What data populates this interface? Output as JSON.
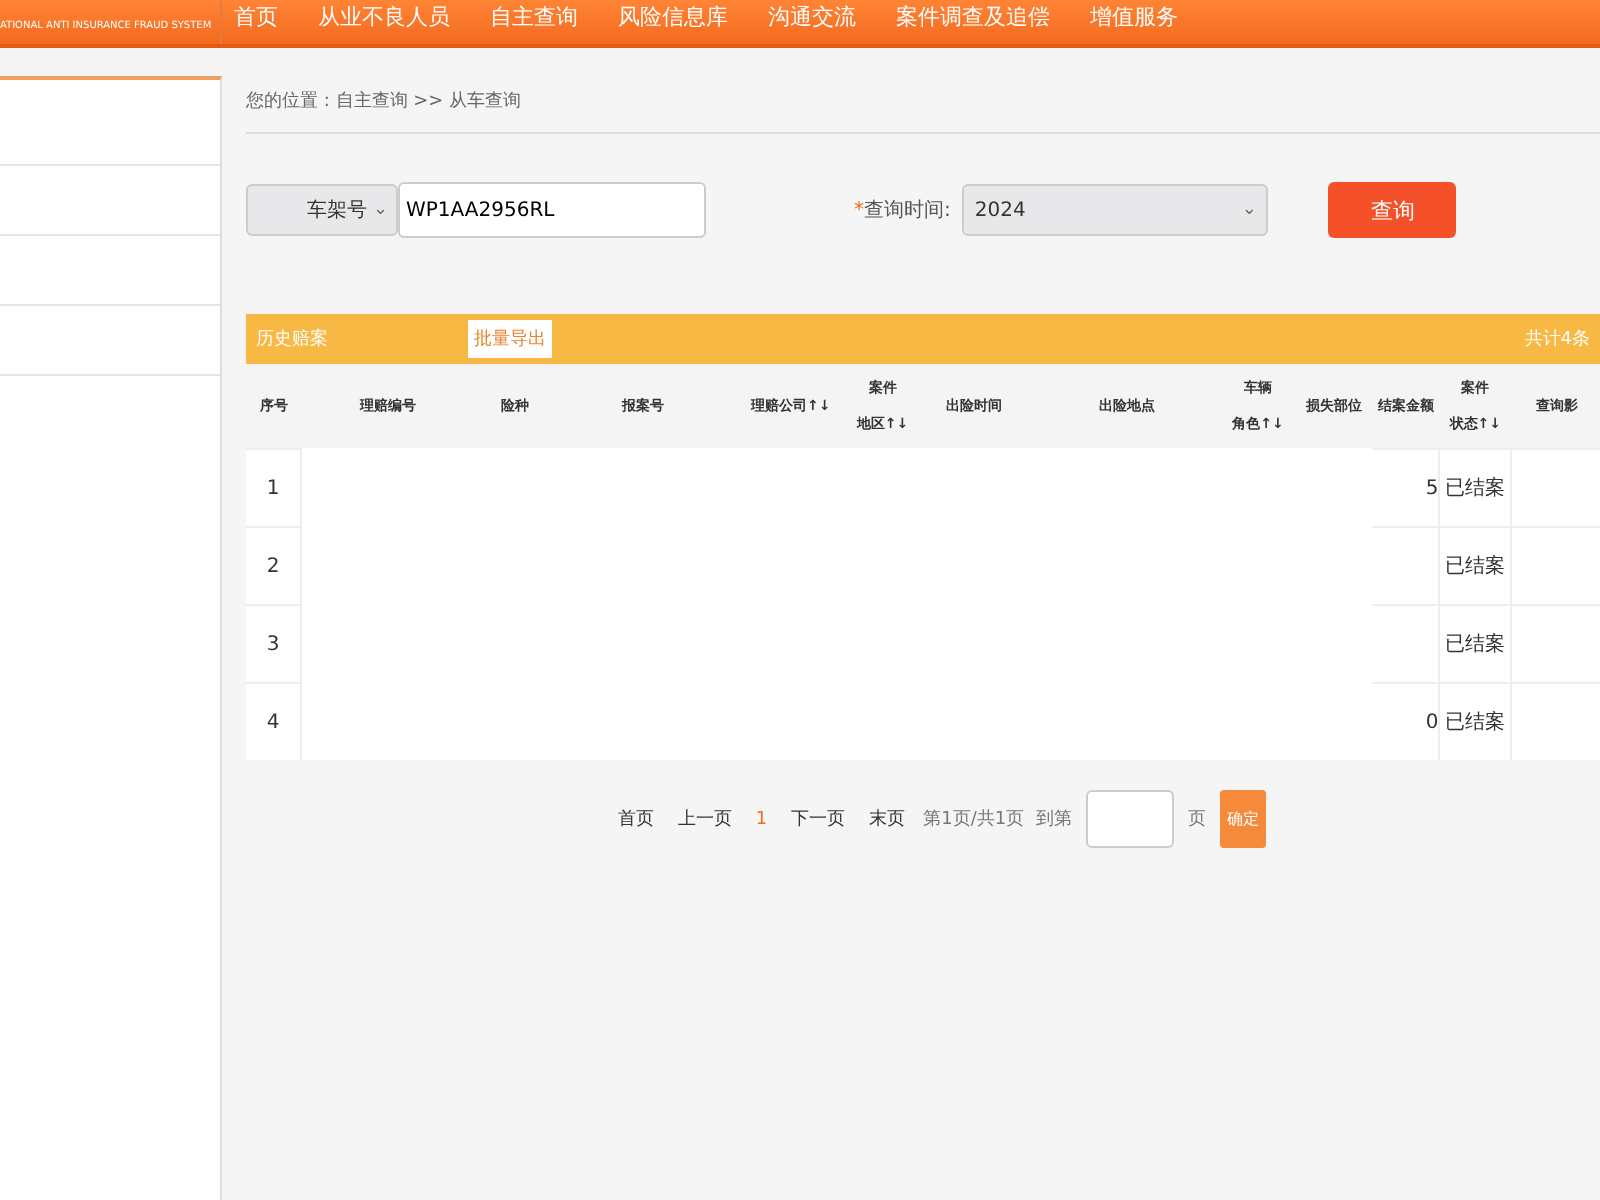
{
  "logo": {
    "subtitle": "ATIONAL ANTI INSURANCE FRAUD SYSTEM"
  },
  "nav": [
    {
      "label": "首页"
    },
    {
      "label": "从业不良人员"
    },
    {
      "label": "自主查询"
    },
    {
      "label": "风险信息库"
    },
    {
      "label": "沟通交流"
    },
    {
      "label": "案件调查及追偿"
    },
    {
      "label": "增值服务"
    }
  ],
  "breadcrumb": "您的位置 : 自主查询 >> 从车查询",
  "search": {
    "type_select": "车架号",
    "chevron": "⌄",
    "required_mark": "*",
    "value": "WP1AA2956RL",
    "time_label": "查询时间:",
    "time_value": "2024",
    "button": "查询"
  },
  "panel": {
    "title": "历史赔案",
    "export_button": "批量导出",
    "total": "共计4条"
  },
  "table": {
    "columns": [
      {
        "lines": [
          "序号"
        ]
      },
      {
        "lines": [
          "理赔编号"
        ]
      },
      {
        "lines": [
          "险种"
        ]
      },
      {
        "lines": [
          "报案号"
        ]
      },
      {
        "lines": [
          "理赔公司↑↓"
        ]
      },
      {
        "lines": [
          "案件",
          "地区↑↓"
        ]
      },
      {
        "lines": [
          "出险时间"
        ]
      },
      {
        "lines": [
          "出险地点"
        ]
      },
      {
        "lines": [
          "车辆",
          "角色↑↓"
        ]
      },
      {
        "lines": [
          "损失部位"
        ]
      },
      {
        "lines": [
          "结案金额"
        ]
      },
      {
        "lines": [
          "案件",
          "状态↑↓"
        ]
      },
      {
        "lines": [
          "查询影"
        ]
      }
    ],
    "rows": [
      {
        "index": "1",
        "amount": "5",
        "status": "已结案"
      },
      {
        "index": "2",
        "status": "已结案"
      },
      {
        "index": "3",
        "status": "已结案"
      },
      {
        "index": "4",
        "amount": "0",
        "status": "已结案"
      }
    ]
  },
  "pagination": {
    "first": "首页",
    "prev": "上一页",
    "current": "1",
    "next": "下一页",
    "last": "末页",
    "info": "第1页/共1页",
    "goto": "到第",
    "unit": "页",
    "confirm": "确定"
  }
}
